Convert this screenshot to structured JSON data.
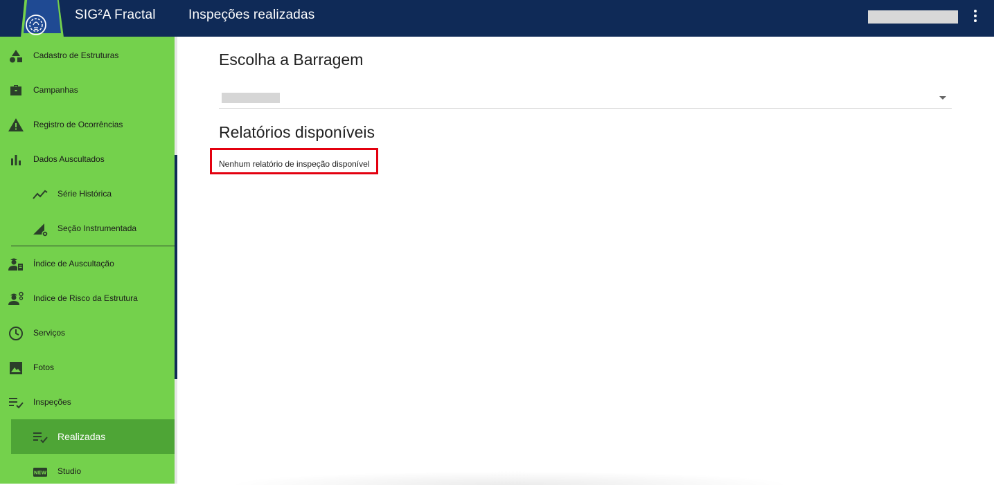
{
  "header": {
    "app_title": "SIG²A Fractal",
    "page_title": "Inspeções realizadas",
    "logo_icon": "gear-bulb-logo-icon",
    "menu_icon": "more-vert-icon",
    "colors": {
      "bar": "#0f2a57",
      "logo_ring": "#74d14c"
    }
  },
  "sidebar": {
    "background": "#74d14c",
    "active_background": "#4ea536",
    "items": [
      {
        "label": "Cadastro de Estruturas",
        "icon": "shapes-icon"
      },
      {
        "label": "Campanhas",
        "icon": "briefcase-icon"
      },
      {
        "label": "Registro de Ocorrências",
        "icon": "warning-icon"
      },
      {
        "label": "Dados Auscultados",
        "icon": "bar-chart-icon"
      },
      {
        "label": "Série Histórica",
        "icon": "trend-line-icon"
      },
      {
        "label": "Seção Instrumentada",
        "icon": "section-gear-icon"
      },
      {
        "label": "Índice de Auscultação",
        "icon": "engineer-report-icon"
      },
      {
        "label": "Indice de Risco da Estrutura",
        "icon": "engineer-gear-icon"
      },
      {
        "label": "Serviços",
        "icon": "clock-icon"
      },
      {
        "label": "Fotos",
        "icon": "image-icon"
      },
      {
        "label": "Inspeções",
        "icon": "playlist-check-icon"
      },
      {
        "label": "Realizadas",
        "icon": "playlist-check-icon"
      },
      {
        "label": "Studio",
        "icon": "new-badge-icon"
      }
    ]
  },
  "main": {
    "dam_heading": "Escolha a Barragem",
    "reports_heading": "Relatórios disponíveis",
    "empty_message": "Nenhum relatório de inspeção disponível",
    "highlight_color": "#e3000f"
  }
}
